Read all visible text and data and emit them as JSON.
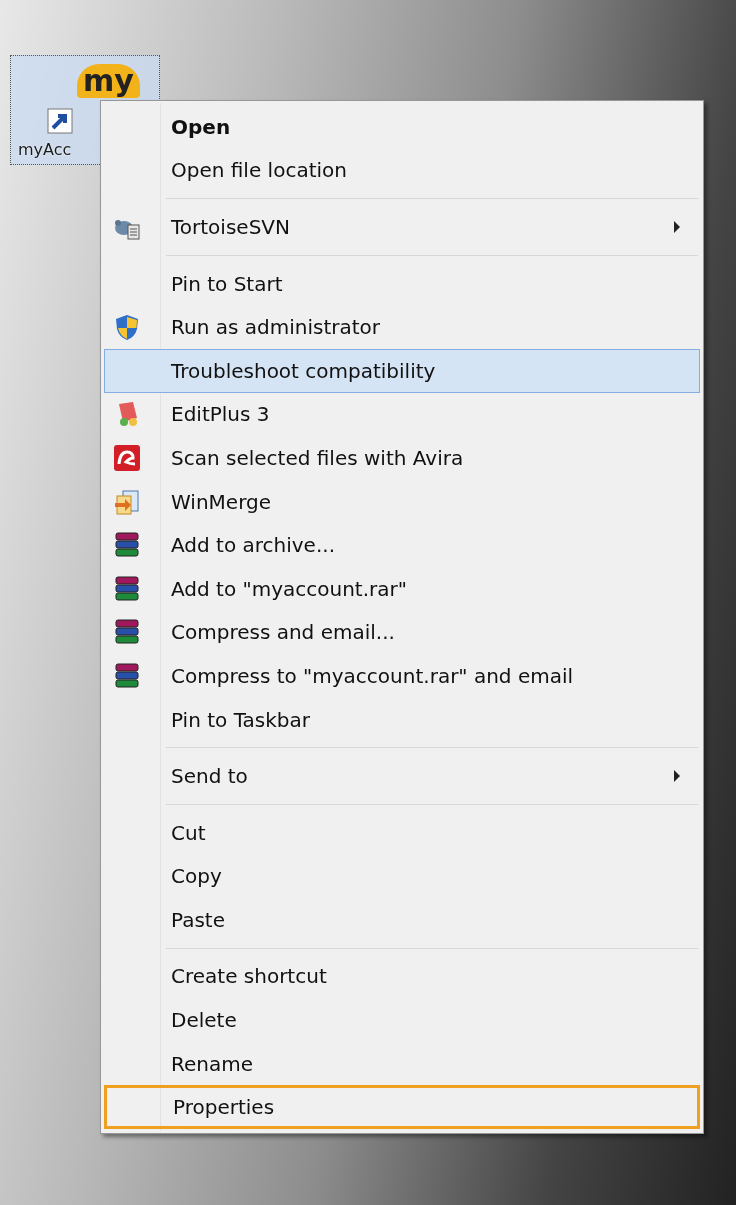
{
  "desktop_icon": {
    "logo_text": "my",
    "label": "myAcc",
    "selected": true
  },
  "menu": {
    "groups": [
      [
        {
          "label": "Open",
          "kind": "text",
          "default": true,
          "submenu": false,
          "selected": false,
          "outlined": false
        },
        {
          "label": "Open file location",
          "kind": "text",
          "default": false,
          "submenu": false,
          "selected": false,
          "outlined": false
        }
      ],
      [
        {
          "label": "TortoiseSVN",
          "kind": "svn",
          "default": false,
          "submenu": true,
          "selected": false,
          "outlined": false
        }
      ],
      [
        {
          "label": "Pin to Start",
          "kind": "text",
          "default": false,
          "submenu": false,
          "selected": false,
          "outlined": false
        },
        {
          "label": "Run as administrator",
          "kind": "shield",
          "default": false,
          "submenu": false,
          "selected": false,
          "outlined": false
        },
        {
          "label": "Troubleshoot compatibility",
          "kind": "text",
          "default": false,
          "submenu": false,
          "selected": true,
          "outlined": false
        },
        {
          "label": "EditPlus 3",
          "kind": "editplus",
          "default": false,
          "submenu": false,
          "selected": false,
          "outlined": false
        },
        {
          "label": "Scan selected files with Avira",
          "kind": "avira",
          "default": false,
          "submenu": false,
          "selected": false,
          "outlined": false
        },
        {
          "label": "WinMerge",
          "kind": "winmerge",
          "default": false,
          "submenu": false,
          "selected": false,
          "outlined": false
        },
        {
          "label": "Add to archive...",
          "kind": "archive",
          "default": false,
          "submenu": false,
          "selected": false,
          "outlined": false
        },
        {
          "label": "Add to \"myaccount.rar\"",
          "kind": "archive",
          "default": false,
          "submenu": false,
          "selected": false,
          "outlined": false
        },
        {
          "label": "Compress and email...",
          "kind": "archive",
          "default": false,
          "submenu": false,
          "selected": false,
          "outlined": false
        },
        {
          "label": "Compress to \"myaccount.rar\" and email",
          "kind": "archive",
          "default": false,
          "submenu": false,
          "selected": false,
          "outlined": false
        },
        {
          "label": "Pin to Taskbar",
          "kind": "text",
          "default": false,
          "submenu": false,
          "selected": false,
          "outlined": false
        }
      ],
      [
        {
          "label": "Send to",
          "kind": "text",
          "default": false,
          "submenu": true,
          "selected": false,
          "outlined": false
        }
      ],
      [
        {
          "label": "Cut",
          "kind": "text",
          "default": false,
          "submenu": false,
          "selected": false,
          "outlined": false
        },
        {
          "label": "Copy",
          "kind": "text",
          "default": false,
          "submenu": false,
          "selected": false,
          "outlined": false
        },
        {
          "label": "Paste",
          "kind": "text",
          "default": false,
          "submenu": false,
          "selected": false,
          "outlined": false
        }
      ],
      [
        {
          "label": "Create shortcut",
          "kind": "text",
          "default": false,
          "submenu": false,
          "selected": false,
          "outlined": false
        },
        {
          "label": "Delete",
          "kind": "text",
          "default": false,
          "submenu": false,
          "selected": false,
          "outlined": false
        },
        {
          "label": "Rename",
          "kind": "text",
          "default": false,
          "submenu": false,
          "selected": false,
          "outlined": false
        },
        {
          "label": "Properties",
          "kind": "text",
          "default": false,
          "submenu": false,
          "selected": false,
          "outlined": true
        }
      ]
    ]
  }
}
